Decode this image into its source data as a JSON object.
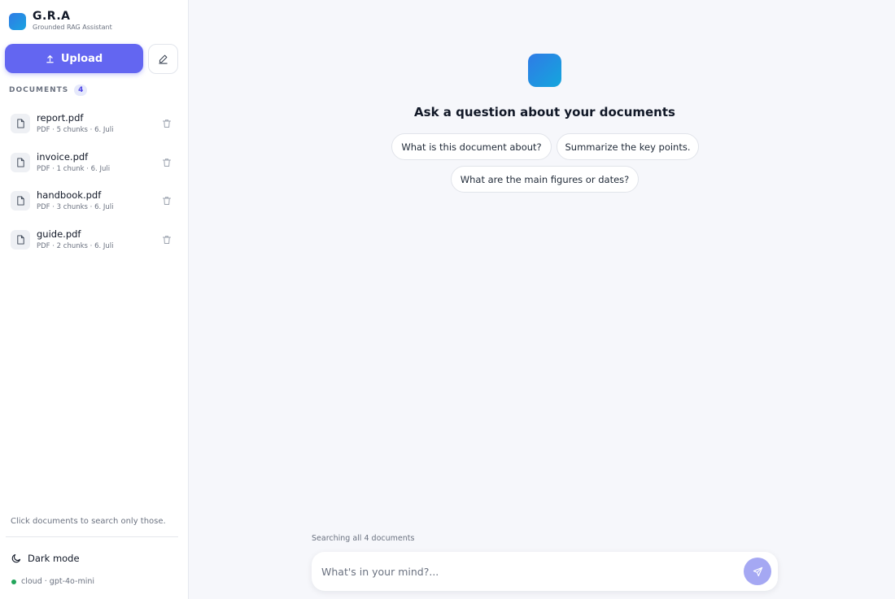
{
  "brand": {
    "title": "G.R.A",
    "subtitle": "Grounded RAG Assistant"
  },
  "actions": {
    "upload_label": "Upload"
  },
  "documents": {
    "header": "DOCUMENTS",
    "count": "4",
    "items": [
      {
        "name": "report.pdf",
        "meta": "PDF · 5 chunks · 6. Juli"
      },
      {
        "name": "invoice.pdf",
        "meta": "PDF · 1 chunk · 6. Juli"
      },
      {
        "name": "handbook.pdf",
        "meta": "PDF · 3 chunks · 6. Juli"
      },
      {
        "name": "guide.pdf",
        "meta": "PDF · 2 chunks · 6. Juli"
      }
    ],
    "hint": "Click documents to search only those."
  },
  "footer": {
    "dark_mode_label": "Dark mode",
    "model_label": "cloud · gpt-4o-mini",
    "status_color": "#22a55a"
  },
  "main": {
    "title": "Ask a question about your documents",
    "suggestions": [
      "What is this document about?",
      "Summarize the key points.",
      "What are the main figures or dates?"
    ],
    "search_scope": "Searching all 4 documents",
    "input_placeholder": "What's in your mind?..."
  },
  "colors": {
    "accent": "#6366f1",
    "send_button": "#a5a8f3"
  }
}
